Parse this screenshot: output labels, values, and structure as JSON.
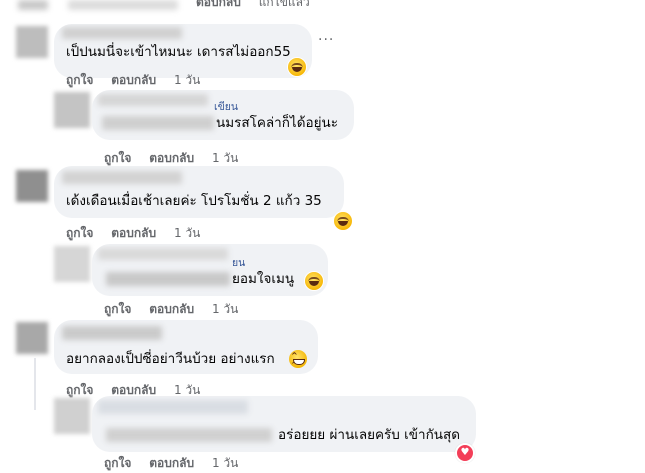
{
  "top_partial": [
    "ตอบกลับ",
    "แก้ไขแล้ว"
  ],
  "comments": [
    {
      "text": "เป็ปนมนี่จะเข้าไหมนะ เดารสไม่ออก55",
      "actions": [
        "ถูกใจ",
        "ตอบกลับ",
        "1 วัน"
      ],
      "emoji": "laughing-emoji"
    },
    {
      "author_fragment": "เขียน",
      "text": "นมรสโคล่าก็ได้อยู่นะ",
      "actions": [
        "ถูกใจ",
        "ตอบกลับ",
        "1 วัน"
      ]
    },
    {
      "text": "เด้งเดือนเมื่อเช้าเลยค่ะ โปรโมชั่น 2 แก้ว 35",
      "actions": [
        "ถูกใจ",
        "ตอบกลับ",
        "1 วัน"
      ],
      "emoji": "rolling-laugh-emoji"
    },
    {
      "author_fragment": "ยน",
      "text": "ยอมใจเมนู",
      "actions": [
        "ถูกใจ",
        "ตอบกลับ",
        "1 วัน"
      ]
    },
    {
      "text": "อยากลองเป็ปซี่อย่าวีนบ้วย อย่างแรก",
      "actions": [
        "ถูกใจ",
        "ตอบกลับ",
        "1 วัน"
      ],
      "emoji": "grinning-emoji"
    },
    {
      "text": "อร่อยยย ผ่านเลยครับ เข้ากันสุด",
      "actions": [
        "ถูกใจ",
        "ตอบกลับ",
        "1 วัน"
      ],
      "reaction": "heart"
    }
  ],
  "more_icon": "···",
  "heart_glyph": "♥",
  "colors": {
    "bubble": "#f0f2f5",
    "meta": "#65676b",
    "heart": "#f33e58"
  }
}
